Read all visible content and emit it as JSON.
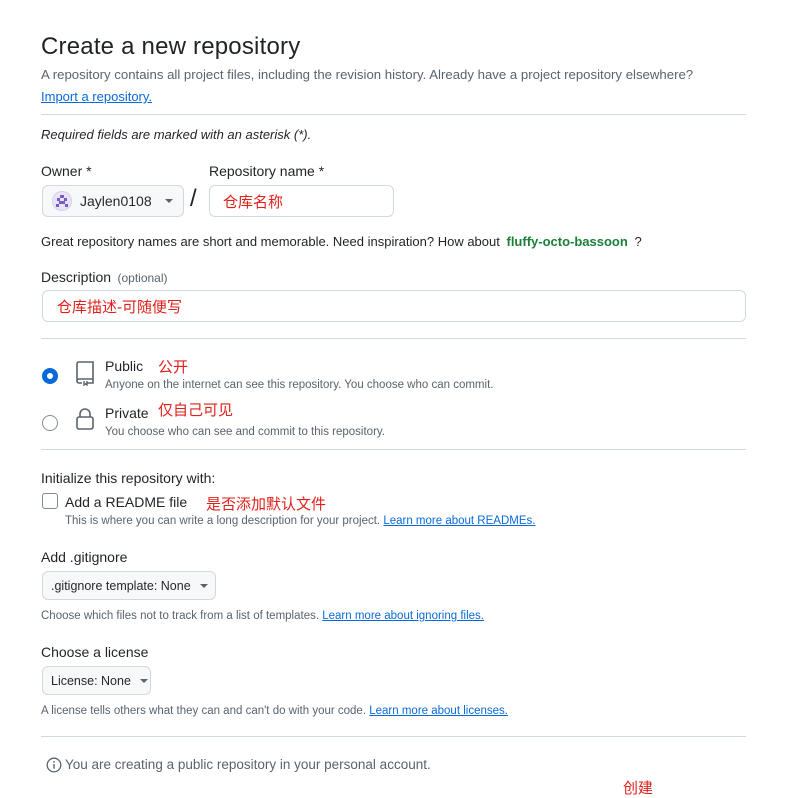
{
  "header": {
    "title": "Create a new repository",
    "subtitle": "A repository contains all project files, including the revision history. Already have a project repository elsewhere?",
    "import_link": "Import a repository."
  },
  "required_note": "Required fields are marked with an asterisk (*).",
  "owner": {
    "label": "Owner *",
    "value": "Jaylen0108"
  },
  "repo_name": {
    "label": "Repository name *",
    "value": "仓库名称"
  },
  "slash": "/",
  "suggestion": {
    "text": "Great repository names are short and memorable. Need inspiration? How about",
    "name": "fluffy-octo-bassoon",
    "end": "?"
  },
  "description": {
    "label": "Description",
    "optional": "(optional)",
    "value": "仓库描述-可随便写"
  },
  "visibility": {
    "public": {
      "label": "Public",
      "note": "公开",
      "desc": "Anyone on the internet can see this repository. You choose who can commit.",
      "checked": true
    },
    "private": {
      "label": "Private",
      "note": "仅自己可见",
      "desc": "You choose who can see and commit to this repository.",
      "checked": false
    }
  },
  "init": {
    "heading": "Initialize this repository with:",
    "readme_label": "Add a README file",
    "readme_note": "是否添加默认文件",
    "readme_desc": "This is where you can write a long description for your project.",
    "readme_link": "Learn more about READMEs."
  },
  "gitignore": {
    "heading": "Add .gitignore",
    "select": ".gitignore template: None",
    "desc": "Choose which files not to track from a list of templates.",
    "link": "Learn more about ignoring files."
  },
  "license": {
    "heading": "Choose a license",
    "select": "License: None",
    "desc": "A license tells others what they can and can't do with your code.",
    "link": "Learn more about licenses."
  },
  "notice": "You are creating a public repository in your personal account.",
  "create_note": "创建",
  "colors": {
    "accent": "#0969da",
    "annotation_red": "#e0201b",
    "suggestion_green": "#1a7f37"
  }
}
